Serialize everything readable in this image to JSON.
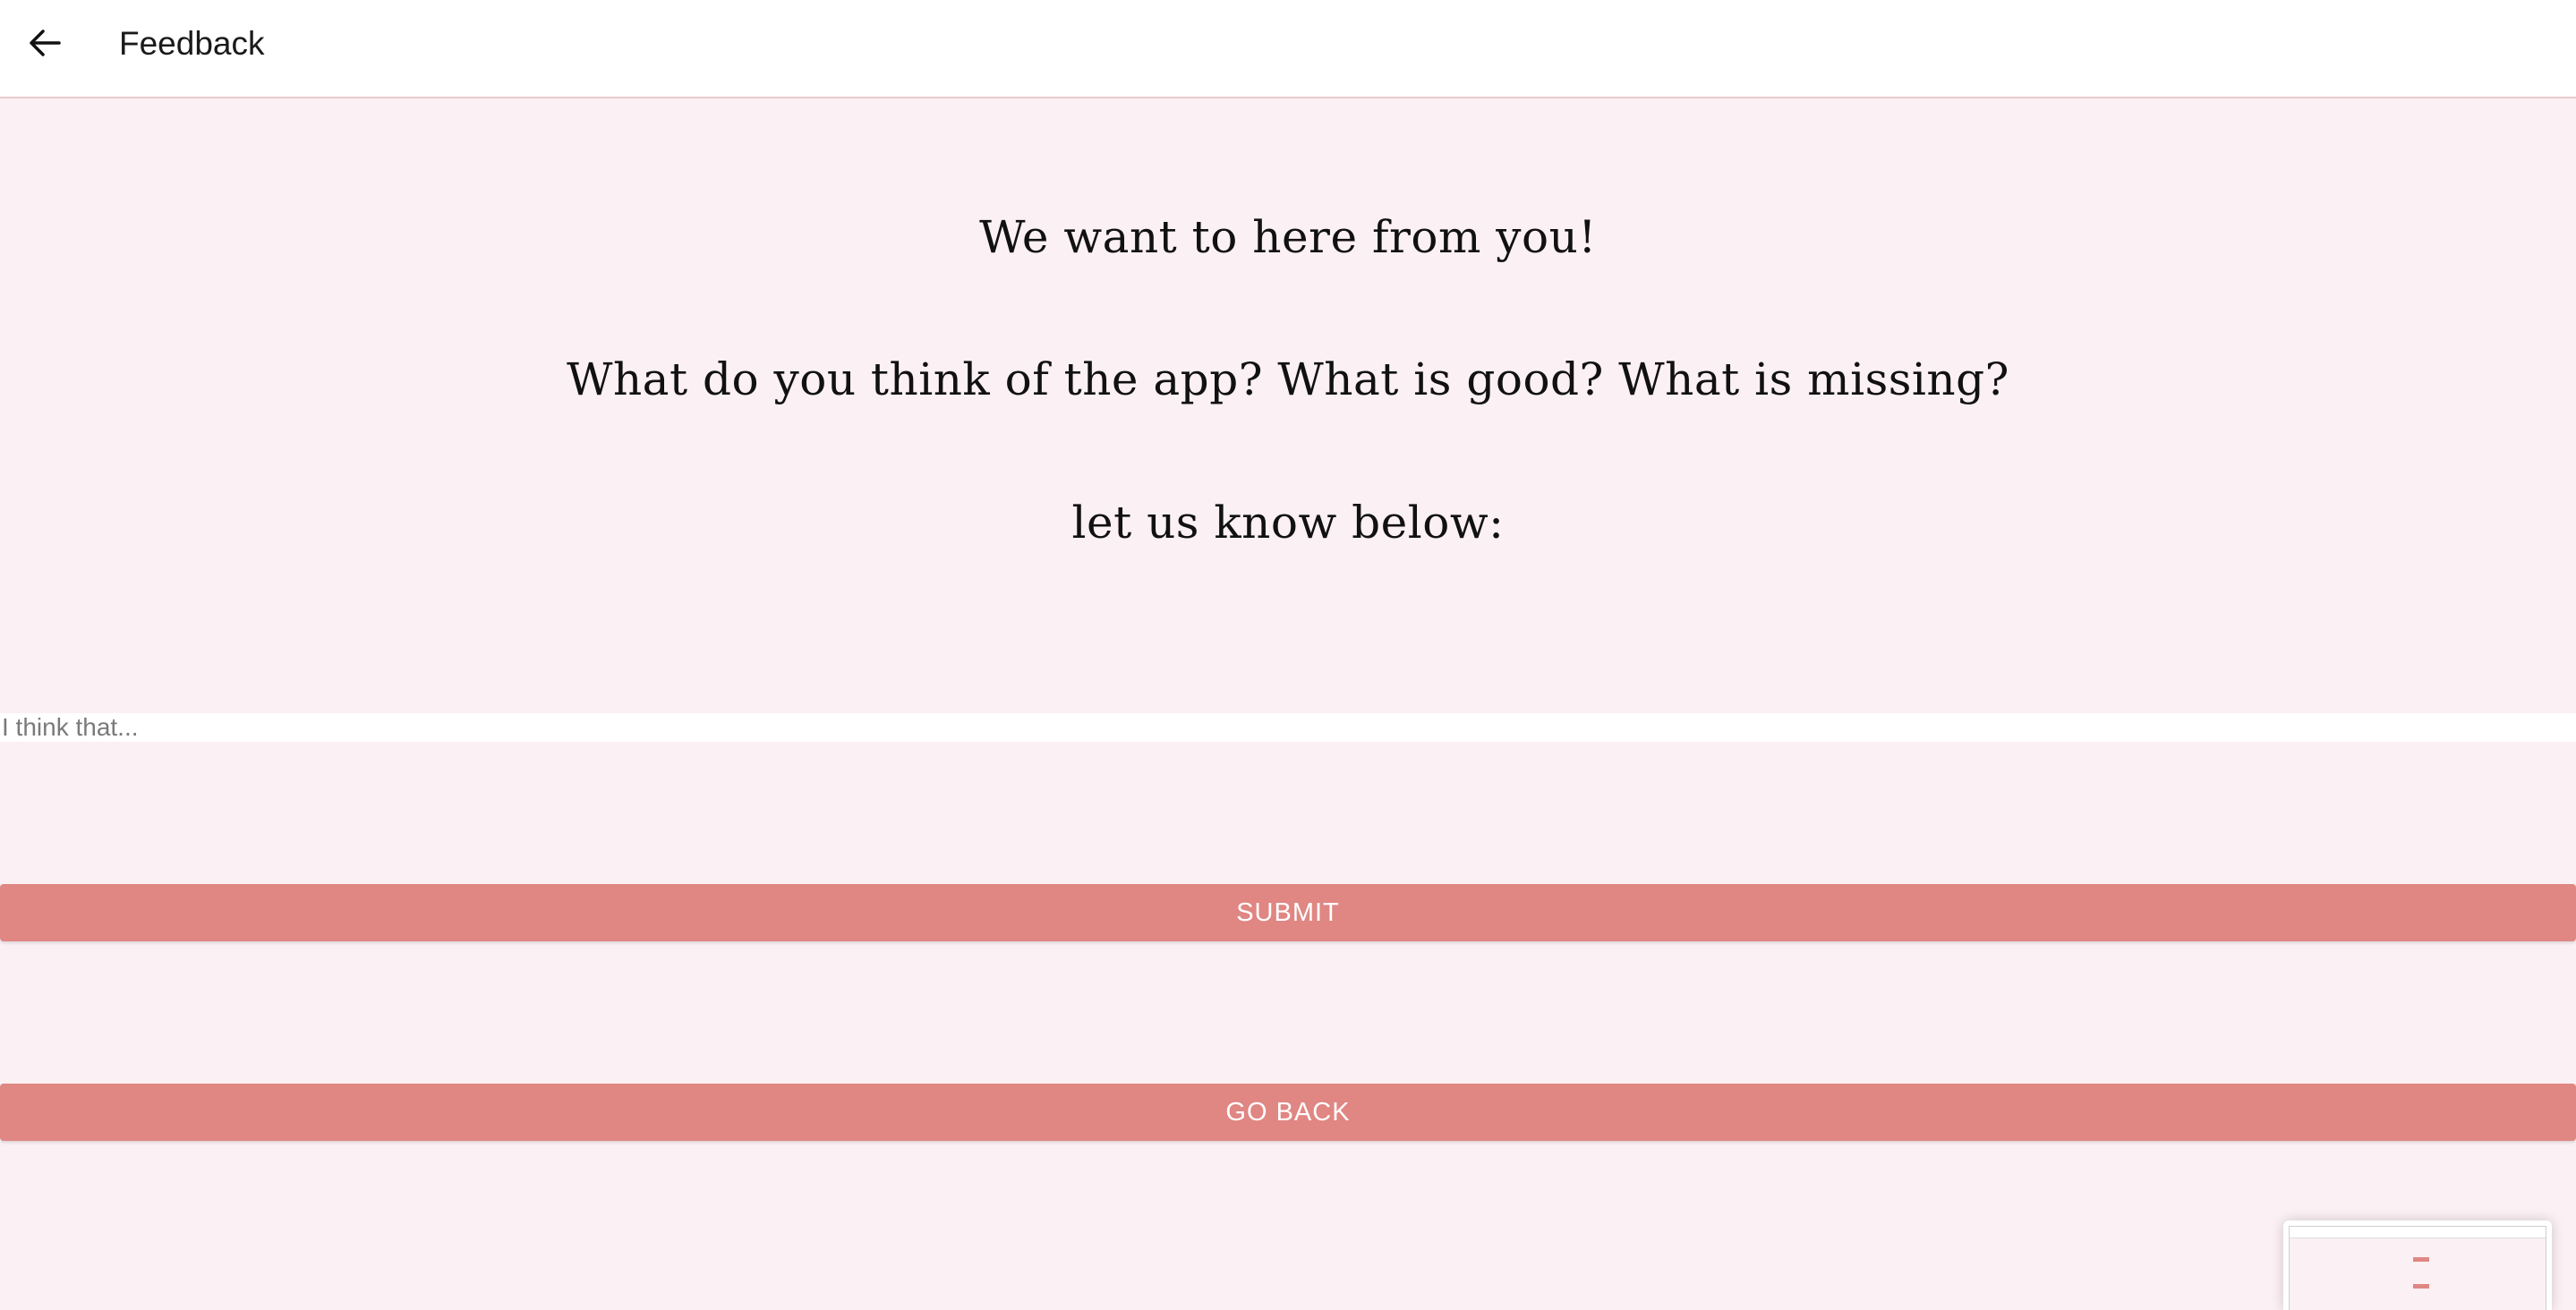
{
  "header": {
    "title": "Feedback",
    "back_icon": "arrow-left-icon"
  },
  "main": {
    "headline_1": "We want to here from you!",
    "headline_2": "What do you think of the app? What is good? What is missing?",
    "headline_3": "let us know below:",
    "input_placeholder": "I think that...",
    "input_value": "",
    "submit_label": "SUBMIT",
    "go_back_label": "GO BACK"
  },
  "colors": {
    "page_background": "#fbf0f3",
    "button_background": "#e08683",
    "button_text": "#ffffff",
    "header_background": "#ffffff"
  }
}
